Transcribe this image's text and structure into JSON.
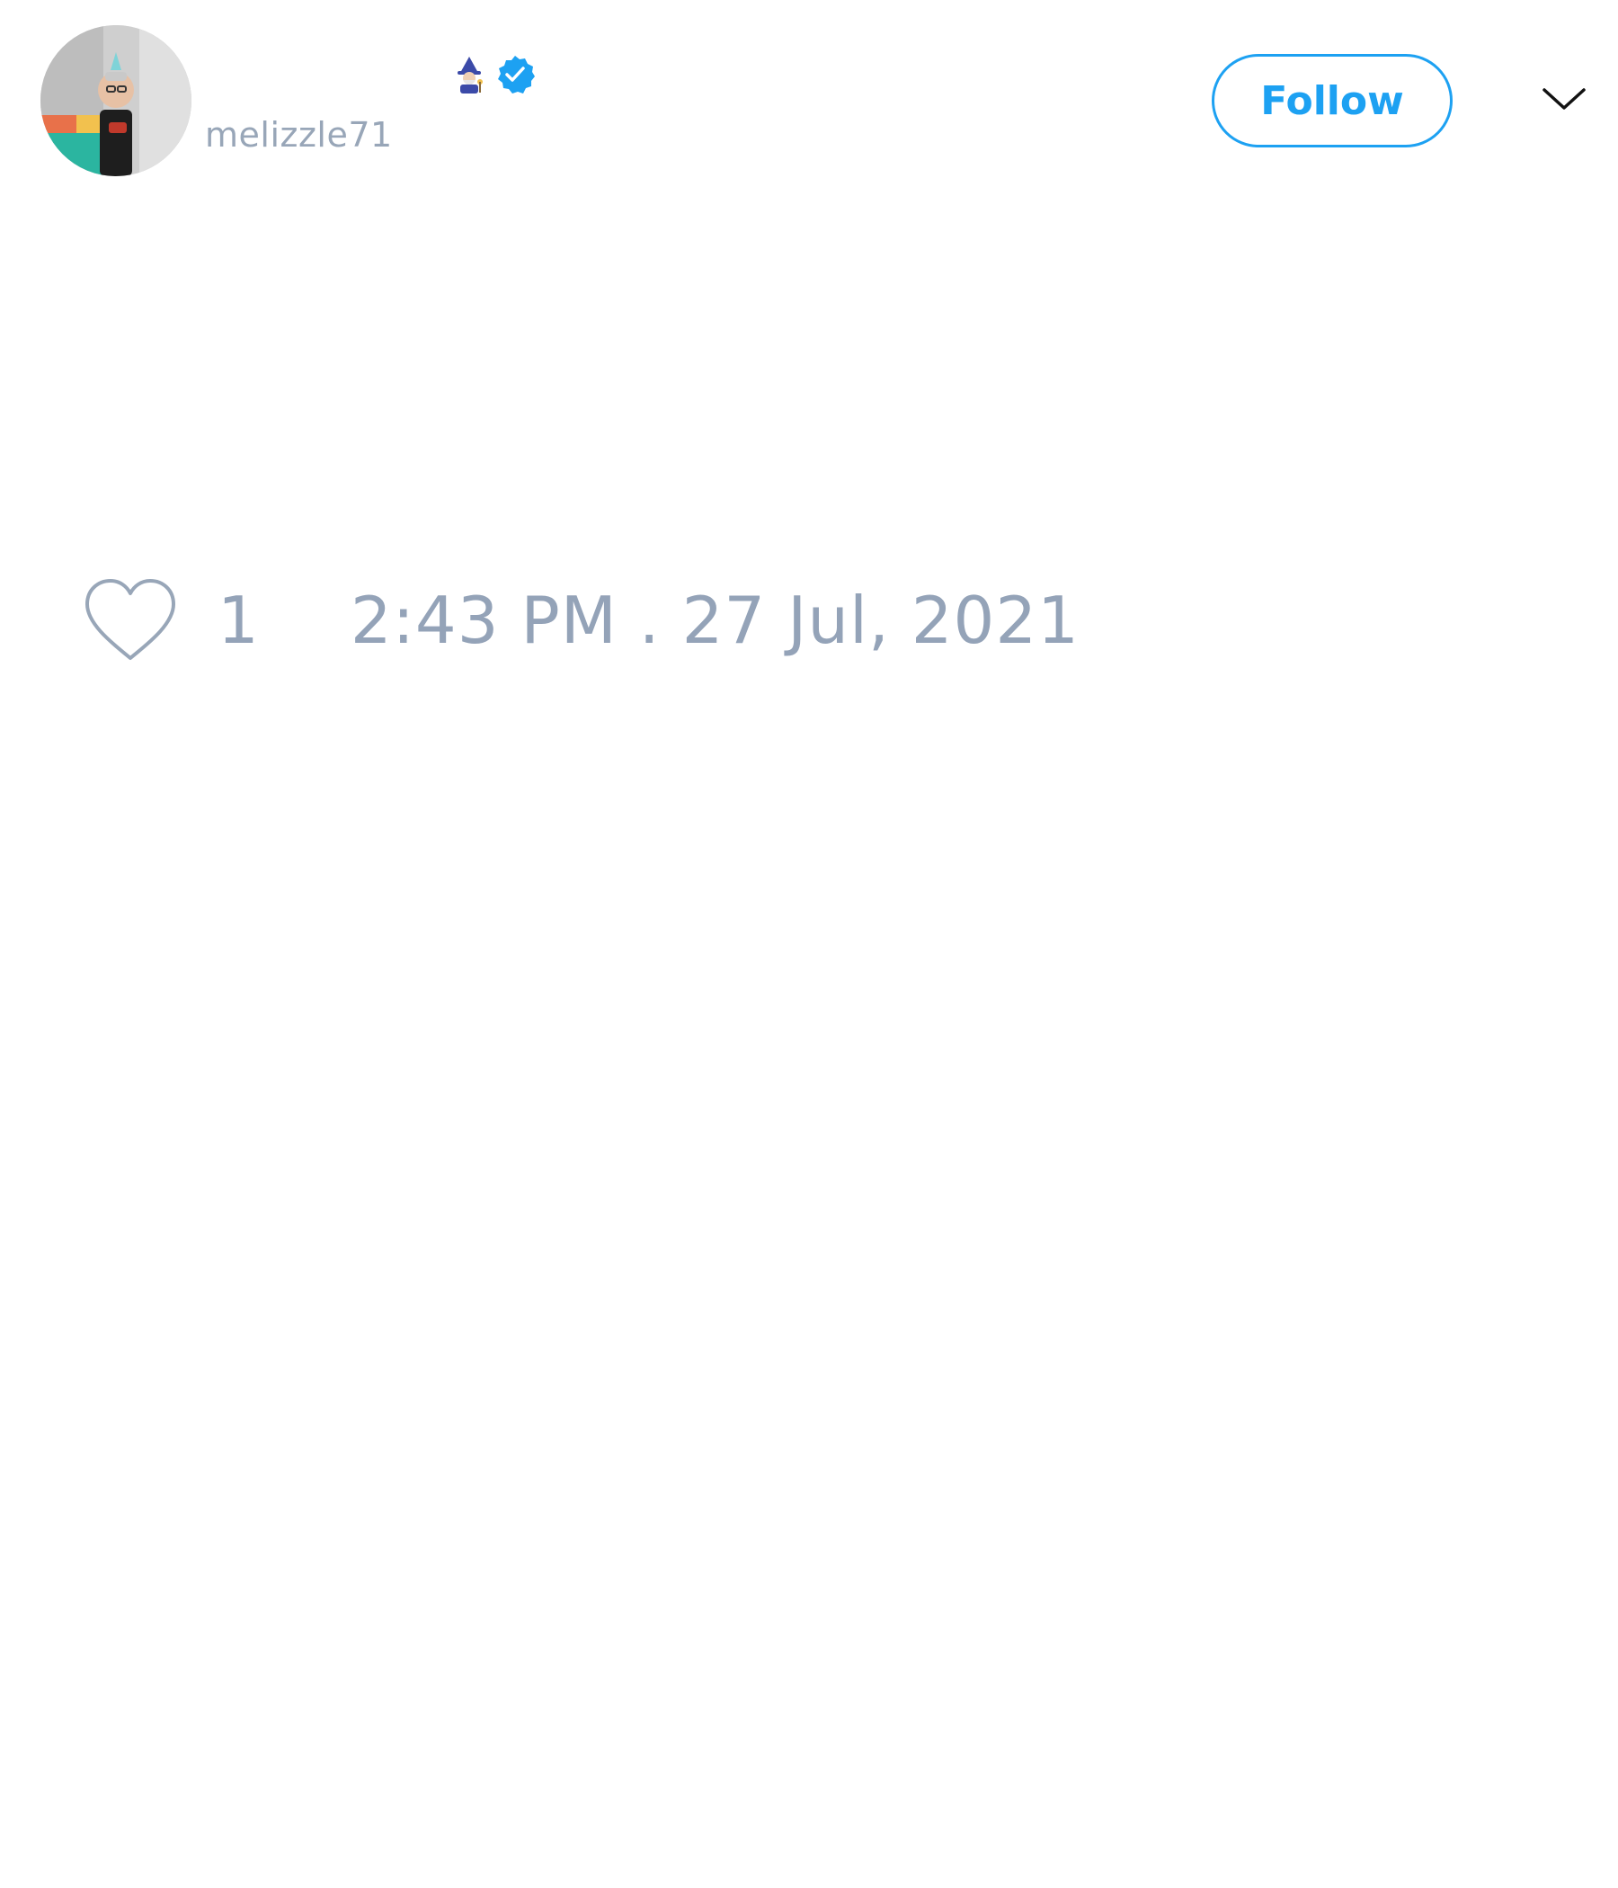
{
  "user": {
    "display_name_emoji": "🧙🏻‍♂️",
    "handle": "melizzle71",
    "verified": true,
    "avatar_icon": "avatar-photo"
  },
  "actions": {
    "follow_label": "Follow",
    "more_icon": "chevron-down-icon"
  },
  "stats": {
    "like_icon": "heart-icon",
    "like_count": "1"
  },
  "meta": {
    "timestamp": "2:43 PM . 27 Jul, 2021"
  },
  "colors": {
    "accent": "#1da1f2",
    "muted_text": "#94a3b8",
    "background": "#ffffff"
  }
}
